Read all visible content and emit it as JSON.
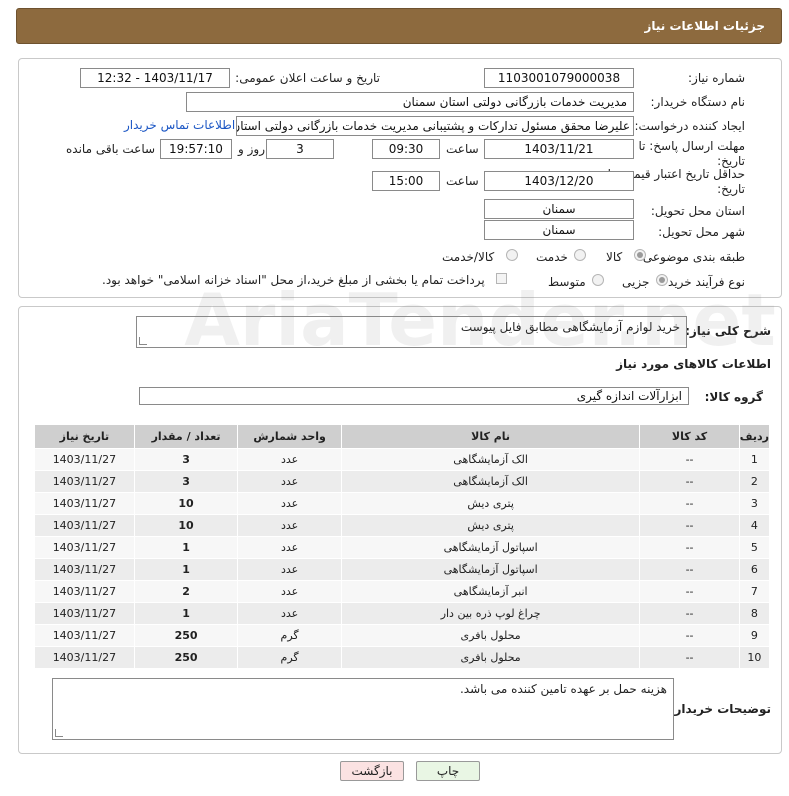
{
  "header": {
    "title": "جزئیات اطلاعات نیاز"
  },
  "form": {
    "need_number_label": "شماره نیاز:",
    "need_number": "1103001079000038",
    "announce_label": "تاریخ و ساعت اعلان عمومی:",
    "announce_value": "1403/11/17 - 12:32",
    "buyer_org_label": "نام دستگاه خریدار:",
    "buyer_org": "مدیریت خدمات بازرگانی دولتی استان سمنان",
    "creator_label": "ایجاد کننده درخواست:",
    "creator": "علیرضا محقق مسئول تدارکات و پشتیبانی مدیریت خدمات بازرگانی دولتی استان",
    "contact_link": "اطلاعات تماس خریدار",
    "deadline_label": "مهلت ارسال پاسخ: تا تاریخ:",
    "deadline_date": "1403/11/21",
    "time_label": "ساعت",
    "deadline_time": "09:30",
    "days_value": "3",
    "days_label": "روز و",
    "remaining_time": "19:57:10",
    "remaining_label": "ساعت باقی مانده",
    "validity_label": "حداقل تاریخ اعتبار قیمت: تا تاریخ:",
    "validity_date": "1403/12/20",
    "validity_time": "15:00",
    "province_label": "استان محل تحویل:",
    "province": "سمنان",
    "city_label": "شهر محل تحویل:",
    "city": "سمنان",
    "category_label": "طبقه بندی موضوعی:",
    "category_options": [
      "کالا",
      "خدمت",
      "کالا/خدمت"
    ],
    "purchase_type_label": "نوع فرآیند خرید :",
    "purchase_options": [
      "جزیی",
      "متوسط"
    ],
    "payment_note": "پرداخت تمام یا بخشی از مبلغ خرید،از محل \"اسناد خزانه اسلامی\" خواهد بود."
  },
  "details": {
    "summary_label": "شرح کلی نیاز:",
    "summary": "خرید لوازم آزمایشگاهی مطابق فایل پیوست",
    "goods_info_title": "اطلاعات کالاهای مورد نیاز",
    "group_label": "گروه کالا:",
    "group_value": "ابزارآلات اندازه گیری"
  },
  "table": {
    "headers": [
      "ردیف",
      "کد کالا",
      "نام کالا",
      "واحد شمارش",
      "تعداد / مقدار",
      "تاریخ نیاز"
    ],
    "rows": [
      [
        "1",
        "--",
        "الک آزمایشگاهی",
        "عدد",
        "3",
        "1403/11/27"
      ],
      [
        "2",
        "--",
        "الک آزمایشگاهی",
        "عدد",
        "3",
        "1403/11/27"
      ],
      [
        "3",
        "--",
        "پتری دیش",
        "عدد",
        "10",
        "1403/11/27"
      ],
      [
        "4",
        "--",
        "پتری دیش",
        "عدد",
        "10",
        "1403/11/27"
      ],
      [
        "5",
        "--",
        "اسپاتول آزمایشگاهی",
        "عدد",
        "1",
        "1403/11/27"
      ],
      [
        "6",
        "--",
        "اسپاتول آزمایشگاهی",
        "عدد",
        "1",
        "1403/11/27"
      ],
      [
        "7",
        "--",
        "انبر آزمایشگاهی",
        "عدد",
        "2",
        "1403/11/27"
      ],
      [
        "8",
        "--",
        "چراغ لوپ ذره بین دار",
        "عدد",
        "1",
        "1403/11/27"
      ],
      [
        "9",
        "--",
        "محلول بافری",
        "گرم",
        "250",
        "1403/11/27"
      ],
      [
        "10",
        "--",
        "محلول بافری",
        "گرم",
        "250",
        "1403/11/27"
      ]
    ]
  },
  "buyer_notes": {
    "label": "توضیحات خریدار:",
    "text": "هزینه حمل بر عهده تامین کننده می باشد."
  },
  "buttons": {
    "print": "چاپ",
    "back": "بازگشت"
  },
  "watermark": {
    "text": "AriaTender.net"
  }
}
